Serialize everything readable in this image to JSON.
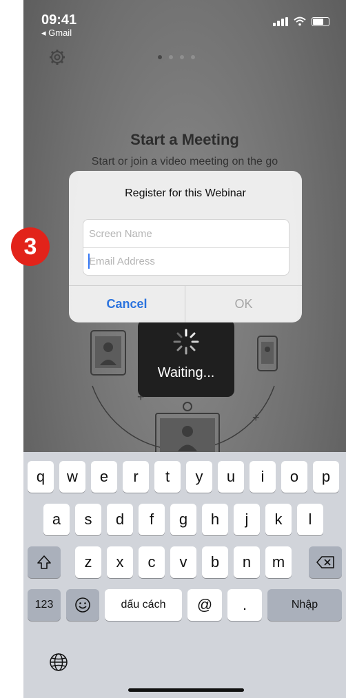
{
  "status_bar": {
    "time": "09:41",
    "back_app": "◂ Gmail"
  },
  "background": {
    "title": "Start a Meeting",
    "subtitle": "Start or join a video meeting on the go",
    "waiting_label": "Waiting..."
  },
  "dialog": {
    "title": "Register for this Webinar",
    "screen_name_placeholder": "Screen Name",
    "email_placeholder": "Email Address",
    "cancel_label": "Cancel",
    "ok_label": "OK"
  },
  "keyboard": {
    "row1": [
      "q",
      "w",
      "e",
      "r",
      "t",
      "y",
      "u",
      "i",
      "o",
      "p"
    ],
    "row2": [
      "a",
      "s",
      "d",
      "f",
      "g",
      "h",
      "j",
      "k",
      "l"
    ],
    "row3": [
      "z",
      "x",
      "c",
      "v",
      "b",
      "n",
      "m"
    ],
    "numbers_label": "123",
    "space_label": "dấu cách",
    "at_label": "@",
    "period_label": ".",
    "return_label": "Nhập"
  },
  "step_badge": "3",
  "colors": {
    "accent": "#2b73de",
    "badge": "#e2231a",
    "keyboard_bg": "#d1d4da"
  }
}
